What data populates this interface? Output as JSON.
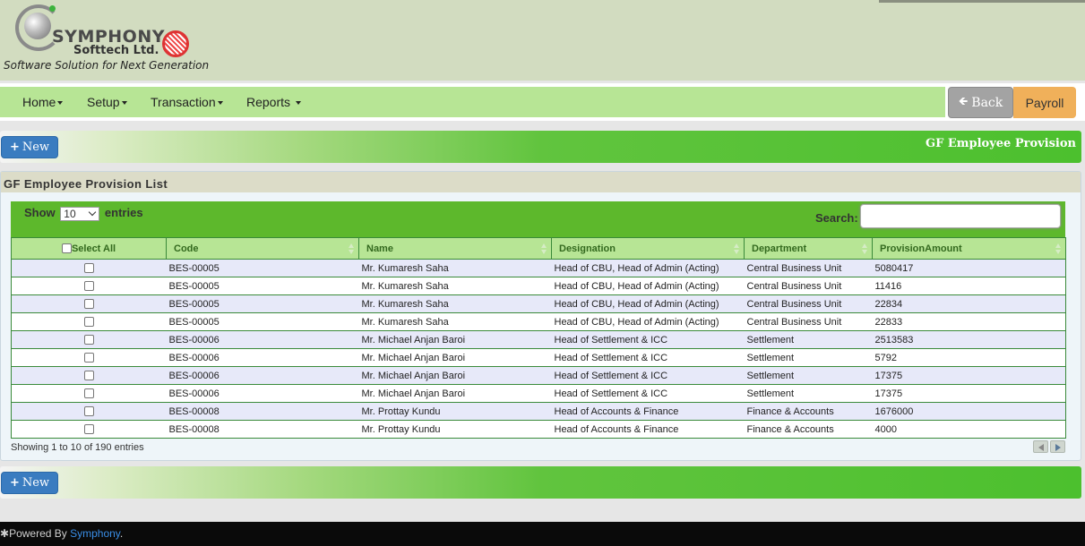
{
  "brand": {
    "name": "SYMPHONY",
    "sub": "Softtech Ltd.",
    "tagline": "Software Solution for Next Generation"
  },
  "nav": {
    "items": [
      {
        "label": "Home"
      },
      {
        "label": "Setup"
      },
      {
        "label": "Transaction"
      },
      {
        "label": "Reports"
      }
    ],
    "back_label": "Back",
    "payroll_label": "Payroll"
  },
  "toolbar": {
    "new_label": "New",
    "page_heading": "GF Employee Provision"
  },
  "panel": {
    "title": "GF Employee Provision List"
  },
  "table": {
    "show_label": "Show",
    "show_value": "10",
    "entries_label": "entries",
    "search_label": "Search:",
    "search_value": "",
    "select_all_label": "Select All",
    "columns": [
      "Code",
      "Name",
      "Designation",
      "Department",
      "ProvisionAmount"
    ],
    "rows": [
      {
        "code": "BES-00005",
        "name": "Mr. Kumaresh Saha",
        "designation": "Head of CBU, Head of Admin (Acting)",
        "department": "Central Business Unit",
        "amount": "5080417"
      },
      {
        "code": "BES-00005",
        "name": "Mr. Kumaresh Saha",
        "designation": "Head of CBU, Head of Admin (Acting)",
        "department": "Central Business Unit",
        "amount": "11416"
      },
      {
        "code": "BES-00005",
        "name": "Mr. Kumaresh Saha",
        "designation": "Head of CBU, Head of Admin (Acting)",
        "department": "Central Business Unit",
        "amount": "22834"
      },
      {
        "code": "BES-00005",
        "name": "Mr. Kumaresh Saha",
        "designation": "Head of CBU, Head of Admin (Acting)",
        "department": "Central Business Unit",
        "amount": "22833"
      },
      {
        "code": "BES-00006",
        "name": "Mr. Michael Anjan Baroi",
        "designation": "Head of Settlement & ICC",
        "department": "Settlement",
        "amount": "2513583"
      },
      {
        "code": "BES-00006",
        "name": "Mr. Michael Anjan Baroi",
        "designation": "Head of Settlement & ICC",
        "department": "Settlement",
        "amount": "5792"
      },
      {
        "code": "BES-00006",
        "name": "Mr. Michael Anjan Baroi",
        "designation": "Head of Settlement & ICC",
        "department": "Settlement",
        "amount": "17375"
      },
      {
        "code": "BES-00006",
        "name": "Mr. Michael Anjan Baroi",
        "designation": "Head of Settlement & ICC",
        "department": "Settlement",
        "amount": "17375"
      },
      {
        "code": "BES-00008",
        "name": "Mr. Prottay Kundu",
        "designation": "Head of Accounts & Finance",
        "department": "Finance & Accounts",
        "amount": "1676000"
      },
      {
        "code": "BES-00008",
        "name": "Mr. Prottay Kundu",
        "designation": "Head of Accounts & Finance",
        "department": "Finance & Accounts",
        "amount": "4000"
      }
    ],
    "info": "Showing 1 to 10 of 190 entries"
  },
  "footer": {
    "prefix": "Powered By ",
    "link": "Symphony",
    "suffix": "."
  },
  "colors": {
    "accent_green": "#4cc02e",
    "nav_green": "#b7e595",
    "new_button_blue": "#3a7cc0",
    "payroll_orange": "#f0b05a"
  }
}
